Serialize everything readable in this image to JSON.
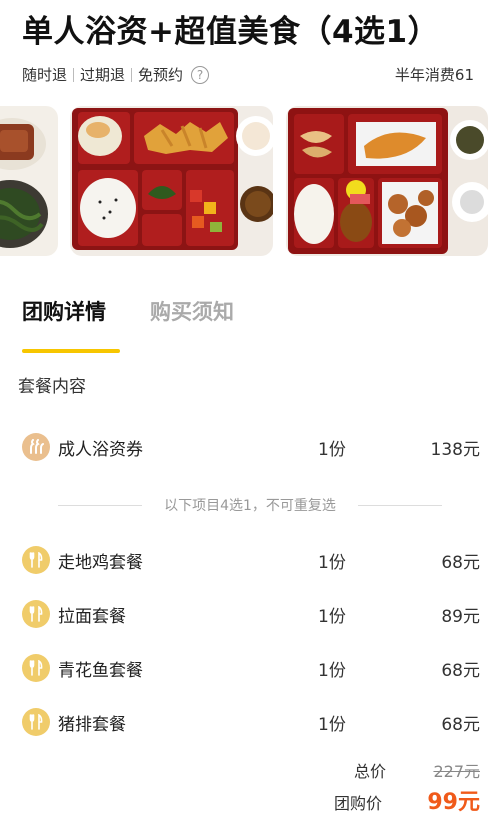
{
  "deal": {
    "title": "单人浴资+超值美食（4选1）",
    "tags": [
      "随时退",
      "过期退",
      "免预约"
    ],
    "sales": "半年消费61"
  },
  "gallery": {
    "icons": [
      "bento-box-photo",
      "bento-box-photo",
      "bento-box-photo"
    ]
  },
  "tabs": [
    {
      "label": "团购详情",
      "active": true
    },
    {
      "label": "购买须知",
      "active": false
    }
  ],
  "package": {
    "section_title": "套餐内容",
    "main_item": {
      "icon": "hot-spring-icon",
      "name": "成人浴资券",
      "qty": "1份",
      "price": "138元"
    },
    "choice_note": "以下项目4选1，不可重复选",
    "choices": [
      {
        "icon": "fork-knife-icon",
        "name": "走地鸡套餐",
        "qty": "1份",
        "price": "68元"
      },
      {
        "icon": "fork-knife-icon",
        "name": "拉面套餐",
        "qty": "1份",
        "price": "89元"
      },
      {
        "icon": "fork-knife-icon",
        "name": "青花鱼套餐",
        "qty": "1份",
        "price": "68元"
      },
      {
        "icon": "fork-knife-icon",
        "name": "猪排套餐",
        "qty": "1份",
        "price": "68元"
      }
    ]
  },
  "pricing": {
    "total_label": "总价",
    "total_value": "227元",
    "group_label": "团购价",
    "group_value": "99元"
  },
  "colors": {
    "accent_yellow": "#f7c600",
    "price_orange": "#f05a1a",
    "bath_icon_bg": "#eabf8e",
    "food_icon_bg": "#f0cc6a"
  }
}
